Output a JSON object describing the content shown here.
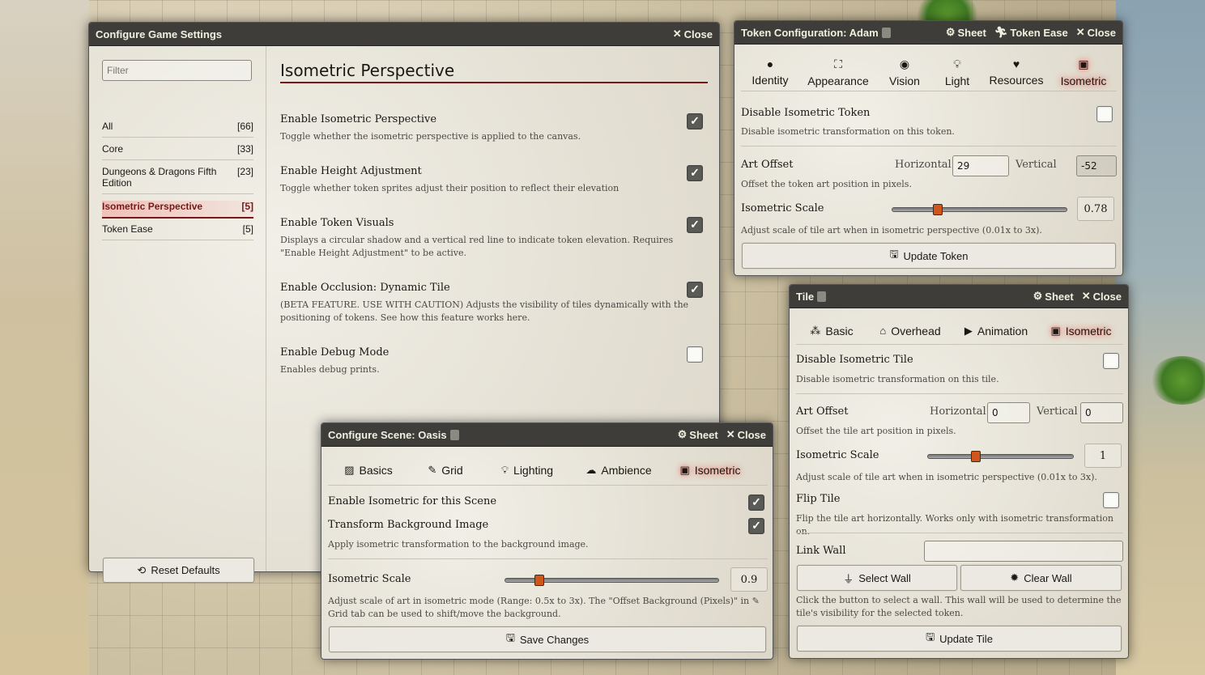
{
  "game_settings": {
    "title": "Configure Game Settings",
    "close_label": "Close",
    "filter_placeholder": "Filter",
    "categories": [
      {
        "label": "All",
        "count": "[66]"
      },
      {
        "label": "Core",
        "count": "[33]"
      },
      {
        "label": "Dungeons & Dragons Fifth Edition",
        "count": "[23]"
      },
      {
        "label": "Isometric Perspective",
        "count": "[5]"
      },
      {
        "label": "Token Ease",
        "count": "[5]"
      }
    ],
    "reset_label": "Reset Defaults",
    "section_title": "Isometric Perspective",
    "settings": [
      {
        "label": "Enable Isometric Perspective",
        "hint": "Toggle whether the isometric perspective is applied to the canvas.",
        "checked": true
      },
      {
        "label": "Enable Height Adjustment",
        "hint": "Toggle whether token sprites adjust their position to reflect their elevation",
        "checked": true
      },
      {
        "label": "Enable Token Visuals",
        "hint": "Displays a circular shadow and a vertical red line to indicate token elevation. Requires \"Enable Height Adjustment\" to be active.",
        "checked": true
      },
      {
        "label": "Enable Occlusion: Dynamic Tile",
        "hint": "(BETA FEATURE. USE WITH CAUTION) Adjusts the visibility of tiles dynamically with the positioning of tokens. See how this feature works here.",
        "checked": true
      },
      {
        "label": "Enable Debug Mode",
        "hint": "Enables debug prints.",
        "checked": false
      }
    ]
  },
  "token_config": {
    "title": "Token Configuration: Adam",
    "sheet_label": "Sheet",
    "token_ease_label": "Token Ease",
    "close_label": "Close",
    "tabs": [
      {
        "label": "Identity",
        "icon": "user-icon"
      },
      {
        "label": "Appearance",
        "icon": "expand-icon"
      },
      {
        "label": "Vision",
        "icon": "eye-icon"
      },
      {
        "label": "Light",
        "icon": "lightbulb-icon"
      },
      {
        "label": "Resources",
        "icon": "heart-icon"
      },
      {
        "label": "Isometric",
        "icon": "cube-icon"
      }
    ],
    "disable_label": "Disable Isometric Token",
    "disable_hint": "Disable isometric transformation on this token.",
    "art_offset_label": "Art Offset",
    "horizontal_label": "Horizontal",
    "horizontal_value": "29",
    "vertical_label": "Vertical",
    "vertical_value": "-52",
    "offset_hint": "Offset the token art position in pixels.",
    "scale_label": "Isometric Scale",
    "scale_value": "0.78",
    "scale_fraction": 0.26,
    "scale_hint": "Adjust scale of tile art when in isometric perspective (0.01x to 3x).",
    "update_label": "Update Token"
  },
  "tile": {
    "title": "Tile",
    "sheet_label": "Sheet",
    "close_label": "Close",
    "tabs": [
      {
        "label": "Basic",
        "icon": "cubes-icon"
      },
      {
        "label": "Overhead",
        "icon": "home-icon"
      },
      {
        "label": "Animation",
        "icon": "play-icon"
      },
      {
        "label": "Isometric",
        "icon": "cube-icon"
      }
    ],
    "disable_label": "Disable Isometric Tile",
    "disable_hint": "Disable isometric transformation on this tile.",
    "art_offset_label": "Art Offset",
    "horizontal_label": "Horizontal",
    "horizontal_value": "0",
    "vertical_label": "Vertical",
    "vertical_value": "0",
    "offset_hint": "Offset the tile art position in pixels.",
    "scale_label": "Isometric Scale",
    "scale_value": "1",
    "scale_fraction": 0.33,
    "scale_hint": "Adjust scale of tile art when in isometric perspective (0.01x to 3x).",
    "flip_label": "Flip Tile",
    "flip_hint": "Flip the tile art horizontally. Works only with isometric transformation on.",
    "link_wall_label": "Link Wall",
    "select_wall_label": "Select Wall",
    "clear_wall_label": "Clear Wall",
    "wall_hint": "Click the button to select a wall. This wall will be used to determine the tile's visibility for the selected token.",
    "update_label": "Update Tile"
  },
  "scene": {
    "title": "Configure Scene: Oasis",
    "sheet_label": "Sheet",
    "close_label": "Close",
    "tabs": [
      {
        "label": "Basics",
        "icon": "image-icon"
      },
      {
        "label": "Grid",
        "icon": "ruler-icon"
      },
      {
        "label": "Lighting",
        "icon": "lightbulb-icon"
      },
      {
        "label": "Ambience",
        "icon": "cloud-sun-icon"
      },
      {
        "label": "Isometric",
        "icon": "cube-icon"
      }
    ],
    "enable_label": "Enable Isometric for this Scene",
    "transform_label": "Transform Background Image",
    "transform_hint": "Apply isometric transformation to the background image.",
    "scale_label": "Isometric Scale",
    "scale_value": "0.9",
    "scale_fraction": 0.16,
    "scale_hint_1": "Adjust scale of art in isometric mode (Range: 0.5x to 3x). The \"Offset Background (Pixels)\" in",
    "scale_hint_grid": "Grid tab",
    "scale_hint_2": "can be used to shift/move the background.",
    "save_label": "Save Changes"
  },
  "colors": {
    "accent": "#7a1717",
    "header": "#3e3d39",
    "slider_knob": "#d0561a"
  }
}
